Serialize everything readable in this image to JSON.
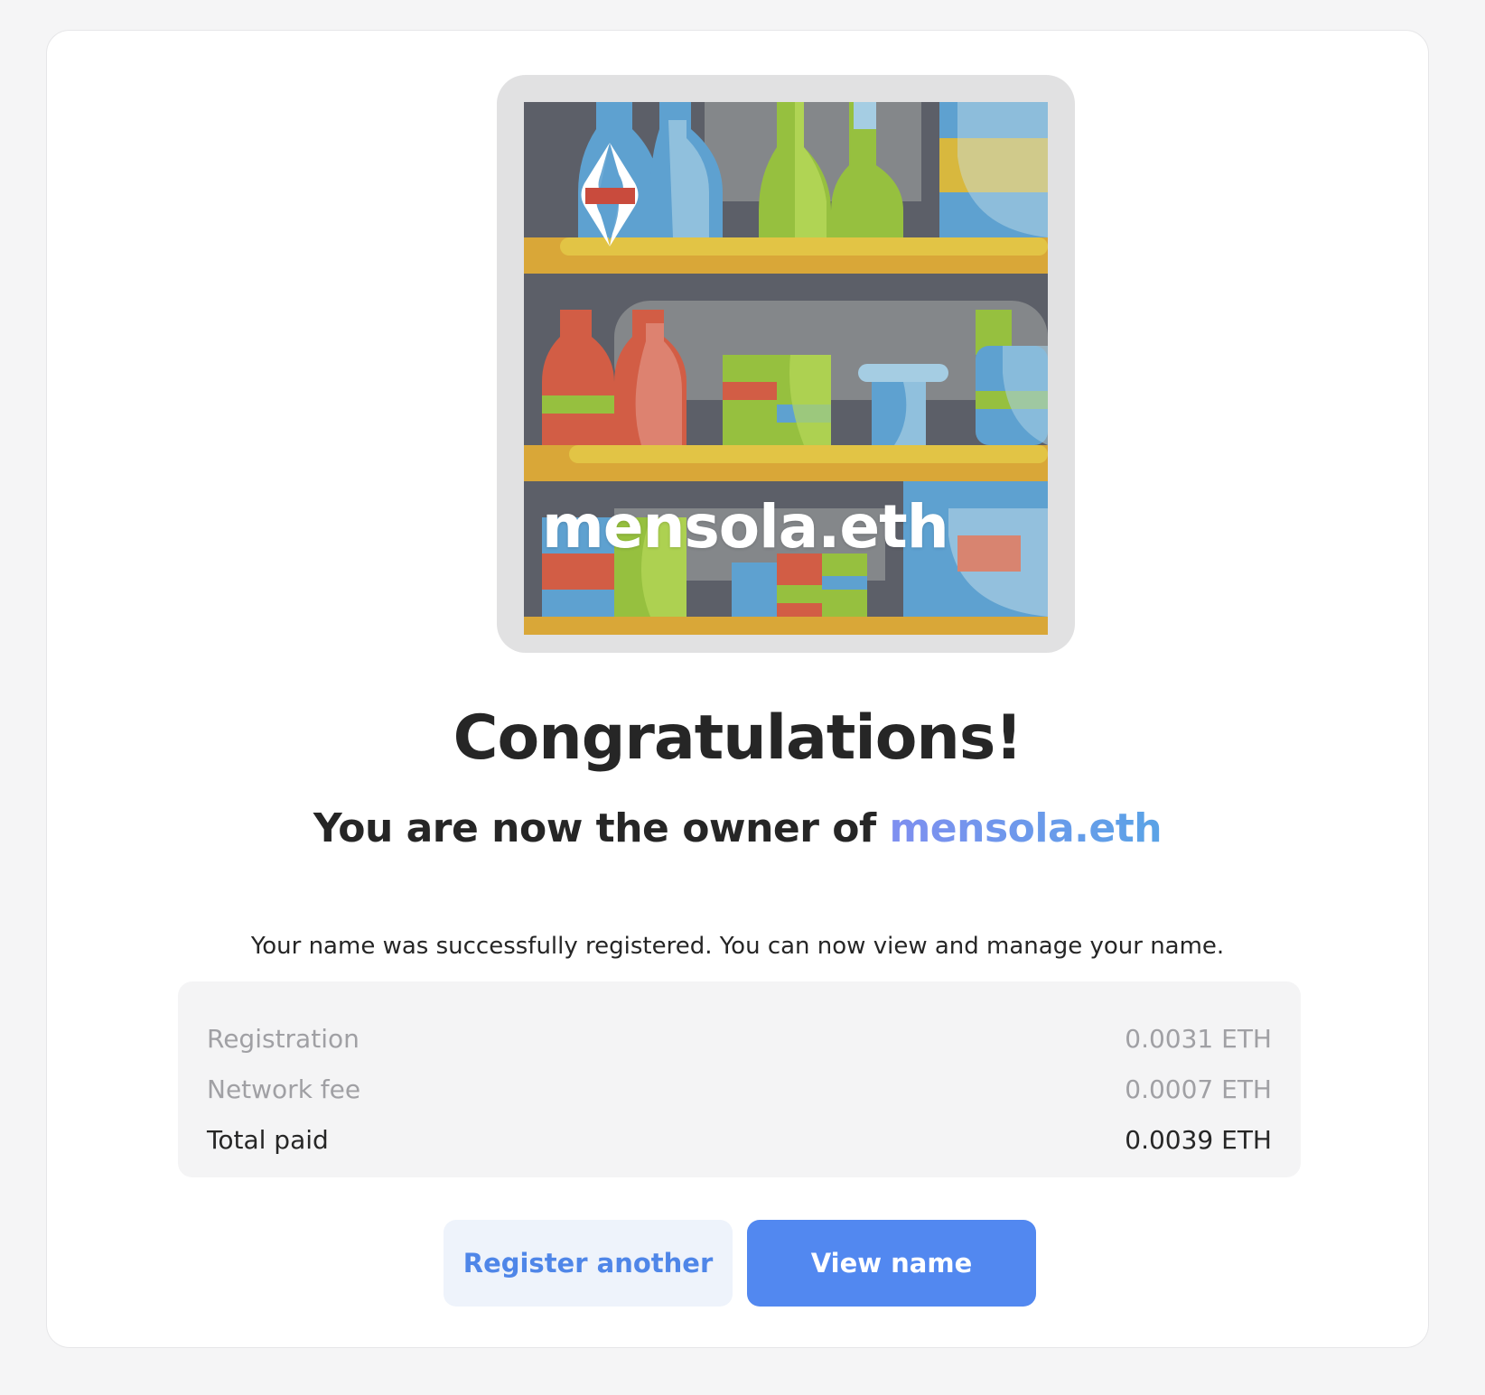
{
  "nft": {
    "label": "mensola.eth",
    "logo_icon": "ens-logo-icon",
    "image_description_icon": "shelf-bottles-illustration"
  },
  "heading": {
    "title": "Congratulations!",
    "subtitle_prefix": "You are now the owner of ",
    "subtitle_name": "mensola.eth"
  },
  "description": "Your name was successfully registered. You can now view and manage your name.",
  "summary": {
    "rows": [
      {
        "label": "Registration",
        "value": "0.0031 ETH"
      },
      {
        "label": "Network fee",
        "value": "0.0007 ETH"
      },
      {
        "label": "Total paid",
        "value": "0.0039 ETH"
      }
    ]
  },
  "actions": {
    "register_another": "Register another",
    "view_name": "View name"
  },
  "colors": {
    "accent": "#5288f0",
    "name_gradient_start": "#7f8ff0",
    "name_gradient_end": "#5aa3e6",
    "background": "#f5f5f6"
  }
}
